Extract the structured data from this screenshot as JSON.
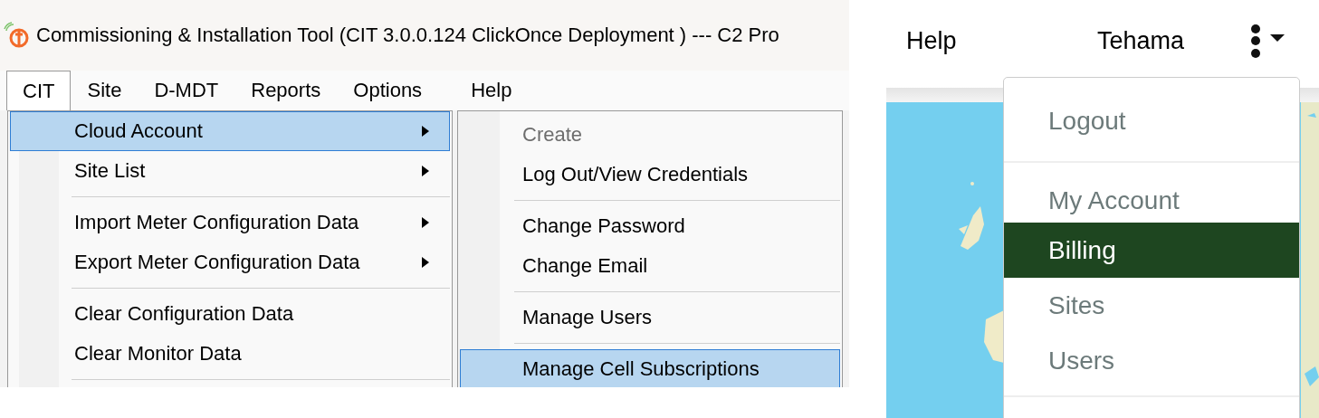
{
  "desktop_app": {
    "title": "Commissioning & Installation Tool (CIT 3.0.0.124 ClickOnce Deployment ) ---  C2 Pro",
    "menu_bar": [
      {
        "label": "CIT",
        "selected": true
      },
      {
        "label": "Site",
        "selected": false
      },
      {
        "label": "D-MDT",
        "selected": false
      },
      {
        "label": "Reports",
        "selected": false
      },
      {
        "label": "Options",
        "selected": false
      },
      {
        "label": "Help",
        "selected": false
      }
    ],
    "menu": [
      {
        "kind": "item",
        "label": "Cloud Account",
        "has_submenu": true,
        "selected": true
      },
      {
        "kind": "item",
        "label": "Site List",
        "has_submenu": true,
        "selected": false
      },
      {
        "kind": "separator"
      },
      {
        "kind": "item",
        "label": "Import Meter Configuration Data",
        "has_submenu": true,
        "selected": false
      },
      {
        "kind": "item",
        "label": "Export Meter Configuration Data",
        "has_submenu": true,
        "selected": false
      },
      {
        "kind": "separator"
      },
      {
        "kind": "item",
        "label": "Clear Configuration Data",
        "has_submenu": false,
        "selected": false
      },
      {
        "kind": "item",
        "label": "Clear Monitor Data",
        "has_submenu": false,
        "selected": false
      },
      {
        "kind": "separator"
      }
    ],
    "submenu": [
      {
        "kind": "item",
        "label": "Create",
        "disabled": true,
        "selected": false
      },
      {
        "kind": "item",
        "label": "Log Out/View Credentials",
        "disabled": false,
        "selected": false
      },
      {
        "kind": "separator"
      },
      {
        "kind": "item",
        "label": "Change Password",
        "disabled": false,
        "selected": false
      },
      {
        "kind": "item",
        "label": "Change Email",
        "disabled": false,
        "selected": false
      },
      {
        "kind": "separator"
      },
      {
        "kind": "item",
        "label": "Manage Users",
        "disabled": false,
        "selected": false
      },
      {
        "kind": "separator"
      },
      {
        "kind": "item",
        "label": "Manage Cell Subscriptions",
        "disabled": false,
        "selected": true
      }
    ]
  },
  "web_app": {
    "nav": [
      {
        "label": "Help"
      },
      {
        "label": "Tehama"
      }
    ],
    "account_menu": [
      {
        "kind": "item",
        "label": "Logout",
        "selected": false
      },
      {
        "kind": "separator"
      },
      {
        "kind": "item",
        "label": "My Account",
        "selected": false
      },
      {
        "kind": "item",
        "label": "Billing",
        "selected": true
      },
      {
        "kind": "item",
        "label": "Sites",
        "selected": false
      },
      {
        "kind": "item",
        "label": "Users",
        "selected": false
      },
      {
        "kind": "separator"
      }
    ]
  }
}
